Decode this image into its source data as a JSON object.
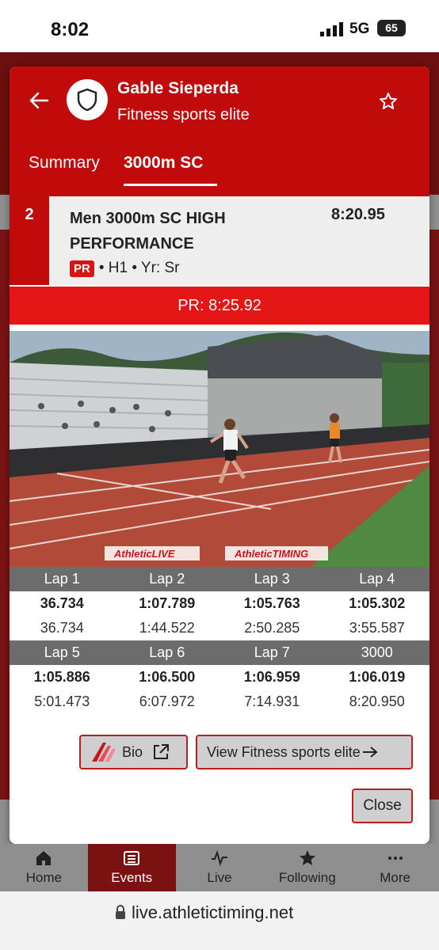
{
  "status_bar": {
    "time": "8:02",
    "network": "5G",
    "battery": "65"
  },
  "header": {
    "athlete_name": "Gable Sieperda",
    "team_name": "Fitness sports elite",
    "tabs": [
      {
        "label": "Summary"
      },
      {
        "label": "3000m SC"
      }
    ]
  },
  "result": {
    "place": "2",
    "event_name": "Men 3000m SC HIGH PERFORMANCE",
    "mark": "8:20.95",
    "badge": "PR",
    "meta": "• H1 • Yr: Sr"
  },
  "pr_banner": "PR: 8:25.92",
  "photo": {
    "watermark_left": "AthleticLIVE",
    "watermark_right": "AthleticTIMING"
  },
  "splits": [
    {
      "label": "Lap 1",
      "lap": "36.734",
      "cumulative": "36.734"
    },
    {
      "label": "Lap 2",
      "lap": "1:07.789",
      "cumulative": "1:44.522"
    },
    {
      "label": "Lap 3",
      "lap": "1:05.763",
      "cumulative": "2:50.285"
    },
    {
      "label": "Lap 4",
      "lap": "1:05.302",
      "cumulative": "3:55.587"
    },
    {
      "label": "Lap 5",
      "lap": "1:05.886",
      "cumulative": "5:01.473"
    },
    {
      "label": "Lap 6",
      "lap": "1:06.500",
      "cumulative": "6:07.972"
    },
    {
      "label": "Lap 7",
      "lap": "1:06.959",
      "cumulative": "7:14.931"
    },
    {
      "label": "3000",
      "lap": "1:06.019",
      "cumulative": "8:20.950"
    }
  ],
  "buttons": {
    "bio": "Bio",
    "view_team": "View Fitness sports elite",
    "close": "Close"
  },
  "bottom_nav": [
    {
      "label": "Home",
      "icon": "home-icon"
    },
    {
      "label": "Events",
      "icon": "list-icon"
    },
    {
      "label": "Live",
      "icon": "pulse-icon"
    },
    {
      "label": "Following",
      "icon": "star-icon"
    },
    {
      "label": "More",
      "icon": "dots-icon"
    }
  ],
  "browser": {
    "url": "live.athletictiming.net"
  },
  "colors": {
    "brand_red": "#c10a0a",
    "banner_red": "#e41616",
    "split_header": "#6c6c6c"
  }
}
